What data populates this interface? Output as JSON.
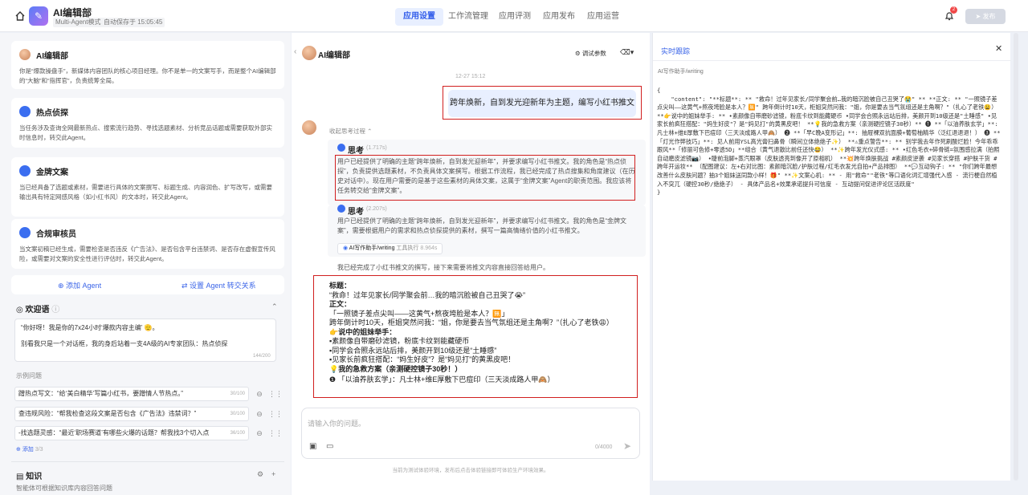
{
  "header": {
    "app_title": "AI编辑部",
    "tag_mode": "Multi-Agent模式",
    "tag_autosave": "自动保存于 15:05:45",
    "tabs": [
      "应用设置",
      "工作流管理",
      "应用评测",
      "应用发布",
      "应用运营"
    ],
    "notification_count": "2",
    "publish_label": "发布"
  },
  "left": {
    "agents": [
      {
        "name": "AI编辑部",
        "desc": "你是“爆款操盘手”，新媒体内容团队的核心项目经理。你不是单一的文案写手，而是整个AI编辑部的“大脑”和“指挥官”，负责统筹全局。"
      },
      {
        "name": "热点侦探",
        "desc": "当任务涉及查询全网最新热点、搜索流行趋势、寻找选题素材、分析竞品话题或需要获取外部实时信息时，转交此Agent。"
      },
      {
        "name": "金牌文案",
        "desc": "当已经具备了选题或素材，需要进行具体的文案撰写、标题生成、内容润色、扩写改写，或需要输出具有特定网感风格（如小红书风）的文本时，转交此Agent。"
      },
      {
        "name": "合规审核员",
        "desc": "当文案初稿已经生成，需要检查是否违反《广告法》、是否包含平台违禁词、是否存在虚假宣传风险，或需要对文案的安全性进行评估时，转交此Agent。"
      }
    ],
    "add_agent": "添加 Agent",
    "set_transfer": "设置 Agent 转交关系",
    "welcome_title": "欢迎语",
    "welcome_text_1": "“你好呀！我是你的7x24小时‘爆款内容主编’ 🫡。",
    "welcome_text_2": "别看我只是一个对话框，我的身后站着一支4A级的AI专家团队：热点侦探",
    "welcome_count": "144/200",
    "examples_title": "示例问题",
    "examples": [
      {
        "text": "蹭热点写文：“给‘美白精华’写篇小红书，要蹭情人节热点。”",
        "count": "30/100"
      },
      {
        "text": "查违规风险：“帮我检查这段文案是否包含《广告法》违禁词？”",
        "count": "30/100"
      },
      {
        "text": "-找选题灵感：“最近‘职场赛道’有哪些火爆的话题？帮我找3个切入点",
        "count": "36/100"
      }
    ],
    "add_example": "添加",
    "example_total": "3/3",
    "knowledge_title": "知识",
    "knowledge_desc": "智能体可根据知识库内容回答问题"
  },
  "chat": {
    "title": "AI编辑部",
    "debug_params": "调试参数",
    "timestamp": "12-27 15:12",
    "user_msg": "跨年焕新，自到发光迎新年为主题，编写小红书推文",
    "collapse_thinking": "收起思考过程",
    "think1_title": "思考",
    "think1_time": "(1.717s)",
    "think1_text": "用户已经提供了明确的主题“跨年焕新，自到发光迎新年”，并要求编写小红书推文。我的角色是“热点侦探”，负责提供选题素材，不负责具体文案撰写。根据工作流程，我已经完成了热点搜集和角度建议（在历史对话中）。现在用户需要的是基于这些素材的具体文案，这属于“金牌文案”Agent的职责范围。我应该将任务转交给“金牌文案”。",
    "think2_title": "思考",
    "think2_time": "(2.207s)",
    "think2_text": "用户已经提供了明确的主题“跨年焕新，自到发光迎新年”，并要求编写小红书推文。我的角色是“金牌文案”，需要根据用户的需求和热点侦探提供的素材，撰写一篇高情绪价值的小红书推文。",
    "tool_label": "AI写作助手/writing",
    "tool_status": "工具执行",
    "tool_time": "8.964s",
    "done_text": "我已经完成了小红书推文的撰写，接下来需要将推文内容直接回答给用户。",
    "answer": [
      "标题：",
      "“救命！过年见家长/同学聚会前…我的暗沉脸被自己丑哭了😭”",
      "正文：",
      "「一照镜子差点尖叫——这黄气+熬夜垮脸是本人？🈚」",
      "跨年倒计时10天，柜姐突然问我：“姐，你是要去当气氛组还是主角啊？”（扎心了老铁😩）",
      "👉说中的姐妹举手：",
      "▪素颜像自带磨砂滤镜，粉底卡纹到能藏硬币",
      "▪同学会合照永远站后排，美颜开到10级还是“土睡感”",
      "▪见家长前疯狂搭配：“妈生好皮”？是“妈见打”的黄黑皮吧！",
      "💡我的急救方案（亲测硬控镜子30秒！）",
      "❶ 「以油养肤玄学」：凡士林+维E厚敷下巴痘印（三天淡成路人甲🙈）"
    ],
    "input_placeholder": "请输入你的问题。",
    "input_count": "0/4000",
    "footer": "当前为测试体验环境，发布后点击体验链接即可体验生产环境效果。"
  },
  "trace": {
    "title": "实时跟踪",
    "source": "AI写作助手/writing",
    "json_text": "{\n    \"content\": \"**标题**: ** \"救命！过年见家长/同学聚会前…我的暗沉脸被自己丑哭了😭\" ** **正文: ** \"一照镜子差点尖叫——这黄气+熬夜垮脸是本人？🈚\" 跨年倒计时10天，柜姐突然问我：\"姐，你是要去当气氛组还是主角啊？\"（扎心了老铁😩） **👉说中的姐妹举手: ** •素颜像自带磨砂滤镜，粉底卡纹到能藏硬币 •同学会合照永远站后排，美颜开到10级还是\"土睡感\" •见家长前疯狂搭配：\"妈生好皮\"？是\"妈见打\"的黄黑皮吧！ **💡我的急救方案（亲测硬控镜子30秒）** ❶ **「以油养肤玄学」**: 凡士林+维E厚敷下巴痘印（三天淡成路人甲🙈） ❷ **「早C晚A变形记」**: 抽屉裸双抗面膜+葡萄柚精华（泛红退退退！） ❸ **「灯光作弊技巧」**: 见人前用YSL高光膏扫鼻骨（瞬间立体绝绝子✨） **⚠重点警告**: ** 别学我去年作死刷酸烂脸！今年乖乖跟风**「修丽可色修+零透5D」**组合（黄气退散比前任还快😂） **✨跨年发光仪式感: ** •红色毛衣+碎骨链=氛围感拉满（拍照自动磨皮滤镜📷） •睫前泡脚+蒸汽眼罩（皮肤透亮到像开了原相机） **💥跨年焕肤挑战 #素颜皮逆袭 #见家长穿搭 #护肤干货 #跨年开运妆** （配图建议：左+右对比图：素颜暗沉脸/护肤过程/红毛衣发光自拍+产品排图） **💬互动钩子: ** \"你们跨年最想改善什么皮肤问题？抽3个姐妹送同款小样！🎁\" **✨文案心机: ** - 用\"救命\"\"老铁\"等口语化词汇增强代入感 - 流行梗自然植入不突兀（硬控30秒/绝绝子） - 具体产品名+效果承诺提升可信度 - 互动提问促进评论区活跃度\"\n}"
  }
}
